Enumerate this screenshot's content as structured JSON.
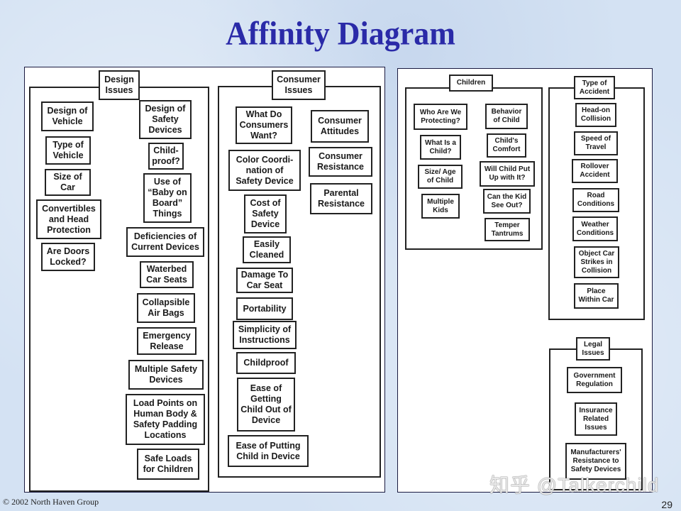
{
  "title": "Affinity Diagram",
  "footer": {
    "copyright": "© 2002 North Haven Group",
    "page_number": "29"
  },
  "watermark": "知乎 @Talkerchild",
  "groups": {
    "design": {
      "header": "Design Issues",
      "items": [
        "Design of Vehicle",
        "Type of Vehicle",
        "Size of Car",
        "Convertibles and Head Protection",
        "Are Doors Locked?",
        "Design of Safety Devices",
        "Child-proof?",
        "Use of “Baby on Board” Things",
        "Deficiencies of Current Devices",
        "Waterbed Car Seats",
        "Collapsible Air Bags",
        "Emergency Release",
        "Multiple Safety Devices",
        "Load Points on Human Body & Safety Padding Locations",
        "Safe Loads for Children"
      ]
    },
    "consumer": {
      "header": "Consumer Issues",
      "items": [
        "What Do Consumers Want?",
        "Color Coordi-nation of Safety Device",
        "Cost of Safety Device",
        "Easily Cleaned",
        "Damage To Car Seat",
        "Portability",
        "Simplicity of Instructions",
        "Childproof",
        "Ease of Getting Child Out of Device",
        "Ease of Putting Child in Device",
        "Consumer Attitudes",
        "Consumer Resistance",
        "Parental Resistance"
      ]
    },
    "children": {
      "header": "Children",
      "items": [
        "Who Are We Protecting?",
        "What Is a Child?",
        "Size/ Age of Child",
        "Multiple Kids",
        "Behavior of Child",
        "Child's Comfort",
        "Will Child Put Up with It?",
        "Can the Kid See Out?",
        "Temper Tantrums"
      ]
    },
    "accident": {
      "header": "Type of Accident",
      "items": [
        "Head-on Collision",
        "Speed of Travel",
        "Rollover Accident",
        "Road Conditions",
        "Weather Conditions",
        "Object Car Strikes in Collision",
        "Place Within Car"
      ]
    },
    "legal": {
      "header": "Legal Issues",
      "items": [
        "Government Regulation",
        "Insurance Related Issues",
        "Manufacturers' Resistance to Safety Devices"
      ]
    }
  }
}
